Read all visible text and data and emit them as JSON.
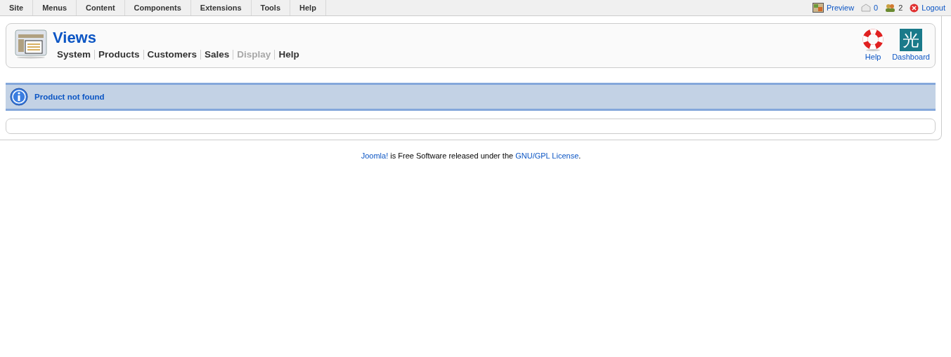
{
  "menu_bar": {
    "items": [
      "Site",
      "Menus",
      "Content",
      "Components",
      "Extensions",
      "Tools",
      "Help"
    ]
  },
  "status": [
    {
      "kind": "preview",
      "label": "Preview"
    },
    {
      "kind": "messages",
      "label": "0"
    },
    {
      "kind": "users",
      "label": "2"
    },
    {
      "kind": "logout",
      "label": "Logout"
    }
  ],
  "header": {
    "title": "Views",
    "submenu": [
      {
        "label": "System",
        "disabled": false
      },
      {
        "label": "Products",
        "disabled": false
      },
      {
        "label": "Customers",
        "disabled": false
      },
      {
        "label": "Sales",
        "disabled": false
      },
      {
        "label": "Display",
        "disabled": true
      },
      {
        "label": "Help",
        "disabled": false
      }
    ],
    "toolbar": [
      {
        "kind": "help",
        "label": "Help"
      },
      {
        "kind": "dashboard",
        "label": "Dashboard",
        "logo_text": "光"
      }
    ]
  },
  "message": {
    "text": "Product not found"
  },
  "footer": {
    "parts": [
      {
        "kind": "link",
        "text": "Joomla!"
      },
      {
        "kind": "text",
        "text": " is Free Software released under the "
      },
      {
        "kind": "link",
        "text": "GNU/GPL License"
      },
      {
        "kind": "text",
        "text": "."
      }
    ]
  }
}
